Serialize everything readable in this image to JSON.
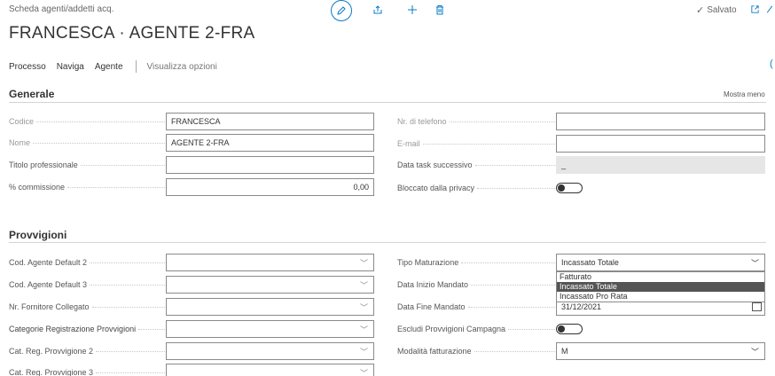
{
  "header": {
    "breadcrumb": "Scheda agenti/addetti acq.",
    "title": "FRANCESCA · AGENTE 2-FRA",
    "saved_label": "Salvato",
    "saved_icon": "check-icon",
    "edit_icon": "pencil-icon",
    "share_icon": "share-icon",
    "new_icon": "plus-icon",
    "delete_icon": "trash-icon",
    "open_new_icon": "open-new-window-icon",
    "collapse_icon": "collapse-icon"
  },
  "actionbar": {
    "items": [
      "Processo",
      "Naviga",
      "Agente"
    ],
    "view_options": "Visualizza opzioni"
  },
  "generale": {
    "title": "Generale",
    "show_less": "Mostra meno",
    "left": [
      {
        "label": "Codice",
        "value": "FRANCESCA"
      },
      {
        "label": "Nome",
        "value": "AGENTE 2-FRA"
      },
      {
        "label": "Titolo professionale",
        "value": ""
      },
      {
        "label": "% commissione",
        "value": "0,00"
      }
    ],
    "right": [
      {
        "label": "Nr. di telefono",
        "value": ""
      },
      {
        "label": "E-mail",
        "value": ""
      },
      {
        "label": "Data task successivo",
        "value": "_"
      },
      {
        "label": "Bloccato dalla privacy",
        "value": false
      }
    ]
  },
  "provvigioni": {
    "title": "Provvigioni",
    "left": [
      {
        "label": "Cod. Agente Default 2",
        "value": ""
      },
      {
        "label": "Cod. Agente Default 3",
        "value": ""
      },
      {
        "label": "Nr. Fornitore Collegato",
        "value": ""
      },
      {
        "label": "Categorie Registrazione Provvigioni",
        "value": ""
      },
      {
        "label": "Cat. Reg. Provvigione 2",
        "value": ""
      },
      {
        "label": "Cat. Reg. Provvigione 3",
        "value": ""
      }
    ],
    "right": [
      {
        "label": "Tipo Maturazione",
        "value": "Incassato Totale"
      },
      {
        "label": "Data Inizio Mandato",
        "value": ""
      },
      {
        "label": "Data Fine Mandato",
        "value": "31/12/2021"
      },
      {
        "label": "Escludi Provvigioni Campagna",
        "value": false
      },
      {
        "label": "Modalità fatturazione",
        "value": "M"
      }
    ],
    "dropdown_options": [
      "Fatturato",
      "Incassato Totale",
      "Incassato Pro Rata"
    ],
    "dropdown_selected": "Incassato Totale"
  },
  "colors": {
    "accent": "#0a7bc4",
    "field_border": "#8a8a8a",
    "readonly_bg": "#e6e6e6",
    "selected_option_bg": "#555555"
  }
}
